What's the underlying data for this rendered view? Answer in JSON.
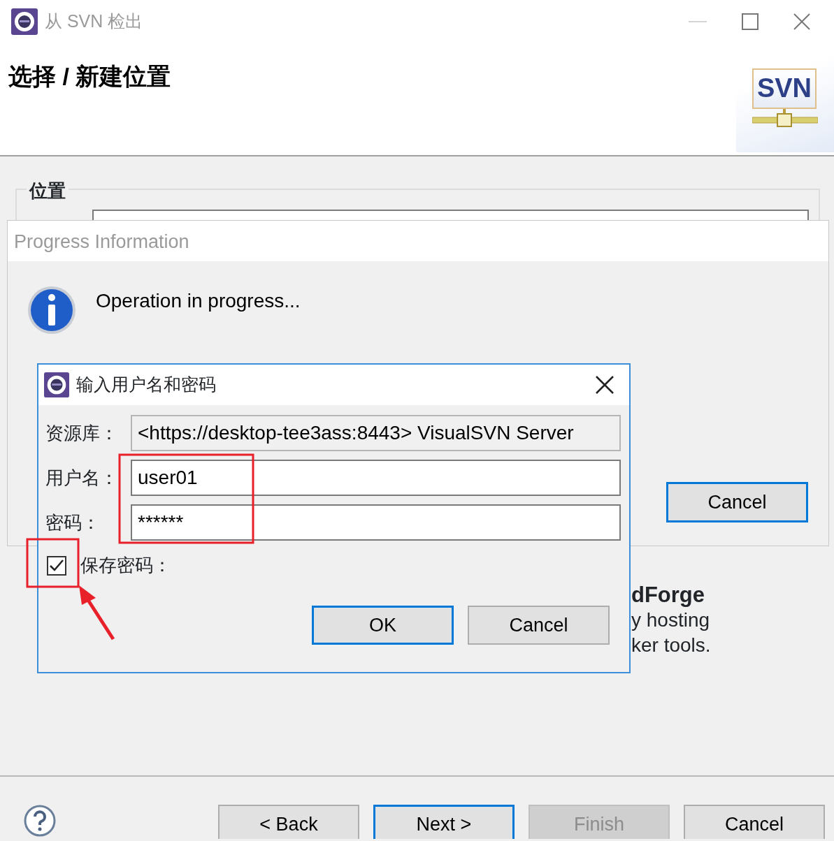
{
  "window": {
    "title": "从 SVN 检出"
  },
  "header": {
    "title": "选择 / 新建位置",
    "logo_text": "SVN"
  },
  "location_group": {
    "label": "位置"
  },
  "background_text": [
    {
      "kind": "heading",
      "text": "dForge"
    },
    {
      "kind": "line",
      "text": "y hosting"
    },
    {
      "kind": "line",
      "text": "ker tools."
    }
  ],
  "progress_dialog": {
    "title": "Progress Information",
    "message": "Operation in progress...",
    "buttons": [
      {
        "label": "Cancel",
        "default": true
      }
    ]
  },
  "login_dialog": {
    "title": "输入用户名和密码",
    "fields": [
      {
        "label": "资源库：",
        "value": "<https://desktop-tee3ass:8443> VisualSVN Server",
        "readonly": true
      },
      {
        "label": "用户名：",
        "value": "user01",
        "readonly": false
      },
      {
        "label": "密码：",
        "value": "******",
        "readonly": false
      }
    ],
    "save_password": {
      "label": "保存密码：",
      "checked": true
    },
    "buttons": [
      {
        "label": "OK",
        "default": true
      },
      {
        "label": "Cancel",
        "default": false
      }
    ]
  },
  "wizard_buttons": [
    {
      "label": "< Back",
      "default": false,
      "disabled": false
    },
    {
      "label": "Next >",
      "default": true,
      "disabled": false
    },
    {
      "label": "Finish",
      "default": false,
      "disabled": true
    },
    {
      "label": "Cancel",
      "default": false,
      "disabled": false
    }
  ]
}
